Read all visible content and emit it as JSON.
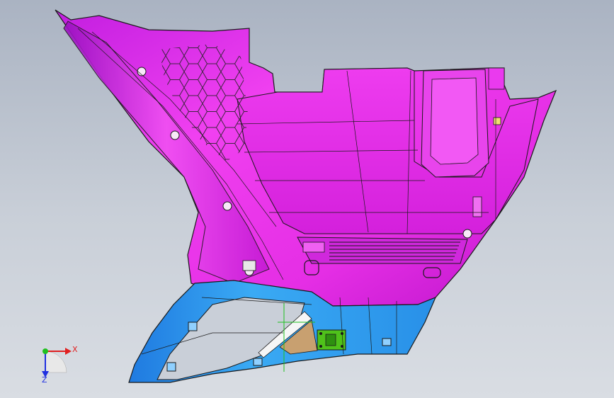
{
  "viewport": {
    "background_top": "#aab3c2",
    "background_bottom": "#d9dde3"
  },
  "part": {
    "upper_color": "#e52ee5",
    "upper_shade": "#b010c8",
    "lower_color": "#33a4f0",
    "lower_shade": "#1a6fd0",
    "clip_color": "#4fc21a",
    "edge_color": "#1a1a1a"
  },
  "triad": {
    "x_label": "X",
    "z_label": "Z",
    "x_color": "#e02020",
    "y_color": "#20c020",
    "z_color": "#2030e0",
    "x_icon": "x-axis-arrow-icon",
    "z_icon": "z-axis-arrow-icon",
    "origin_icon": "triad-origin-icon"
  }
}
